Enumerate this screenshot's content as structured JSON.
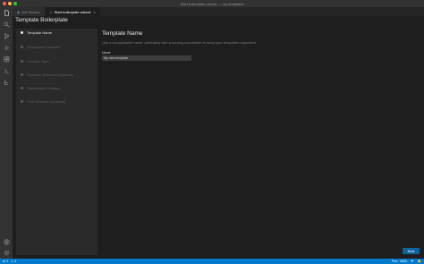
{
  "window": {
    "title": "Start boilerplate wizard — my-templates"
  },
  "tabs": [
    {
      "label": "Get Started",
      "active": false
    },
    {
      "label": "Start boilerplate wizard",
      "active": true
    }
  ],
  "activity_bar": {
    "items": [
      "explorer-icon",
      "search-icon",
      "source-control-icon",
      "run-debug-icon",
      "extensions-icon",
      "remote-icon",
      "tree-icon"
    ],
    "bottom": [
      "account-icon",
      "gear-icon"
    ]
  },
  "wizard": {
    "title": "Template Boilerplate",
    "steps": [
      {
        "label": "Template Name",
        "active": true
      },
      {
        "label": "Workspace Selection",
        "active": false
      },
      {
        "label": "Creation Type",
        "active": false
      },
      {
        "label": "Selection Selection (optional)",
        "active": false
      },
      {
        "label": "Placeholder Creation",
        "active": false
      },
      {
        "label": "Font Selection (optional)",
        "active": false
      }
    ],
    "section_title": "Template Name",
    "description": "Use a recognizable name, preferably with a naming convention to keep your templates organized.",
    "field_label": "Name",
    "field_value": "My new template",
    "next_label": "Next"
  },
  "status_bar": {
    "left": [
      "⊗ 0",
      "⚠ 0"
    ],
    "right": [
      "Port : 5500",
      "⚑",
      "🔔"
    ]
  },
  "colors": {
    "accent": "#007acc",
    "button": "#0e639c",
    "active_step_dot": "#e8e8e8",
    "inactive_step_dot": "#5a5a5a"
  }
}
